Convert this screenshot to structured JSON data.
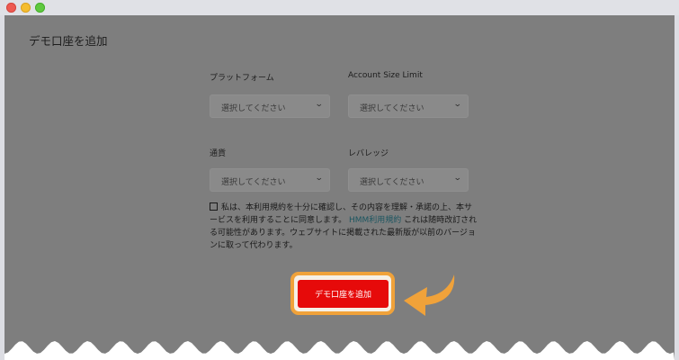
{
  "window": {
    "controls": [
      "close",
      "minimize",
      "zoom"
    ]
  },
  "page": {
    "title": "デモ口座を追加"
  },
  "form": {
    "platform": {
      "label": "プラットフォーム",
      "placeholder": "選択してください"
    },
    "account_size_limit": {
      "label": "Account Size Limit",
      "placeholder": "選択してください"
    },
    "currency": {
      "label": "通貨",
      "placeholder": "選択してください"
    },
    "leverage": {
      "label": "レバレッジ",
      "placeholder": "選択してください"
    },
    "terms": {
      "text_before": "私は、本利用規約を十分に確認し、その内容を理解・承諾の上、本サービスを利用することに同意します。",
      "link": "HMM利用規約",
      "text_after": "これは随時改訂される可能性があります。ウェブサイトに掲載された最新版が以前のバージョンに取って代わります。"
    },
    "submit_label": "デモ口座を追加"
  },
  "colors": {
    "overlay": "#7e7e7e",
    "submit": "#e60a0a",
    "highlight": "#f0a23a",
    "link": "#1b5560"
  },
  "icons": [
    "chevron-down-icon",
    "pointer-arrow-icon"
  ]
}
